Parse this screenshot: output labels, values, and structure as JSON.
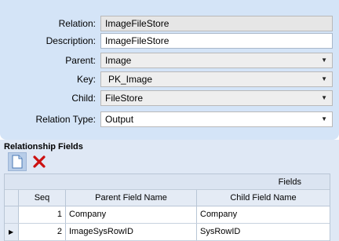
{
  "form": {
    "relation": {
      "label": "Relation:",
      "value": "ImageFileStore"
    },
    "description": {
      "label": "Description:",
      "value": "ImageFileStore"
    },
    "parent": {
      "label": "Parent:",
      "value": "Image"
    },
    "key": {
      "label": "Key:",
      "value": "PK_Image"
    },
    "child": {
      "label": "Child:",
      "value": "FileStore"
    },
    "relation_type": {
      "label": "Relation Type:",
      "value": "Output"
    },
    "dropdown_arrow": "▼"
  },
  "relationship_fields": {
    "title": "Relationship Fields",
    "toolbar": {
      "new_icon": "new-document-icon",
      "delete_icon": "delete-x-icon",
      "delete_color": "#cc1111"
    },
    "grid": {
      "band_title": "Fields",
      "columns": [
        "Seq",
        "Parent Field Name",
        "Child Field Name"
      ],
      "rows": [
        {
          "seq": "1",
          "parent": "Company",
          "child": "Company",
          "current": false
        },
        {
          "seq": "2",
          "parent": "ImageSysRowID",
          "child": "SysRowID",
          "current": true
        }
      ],
      "row_indicator": "▶"
    }
  }
}
